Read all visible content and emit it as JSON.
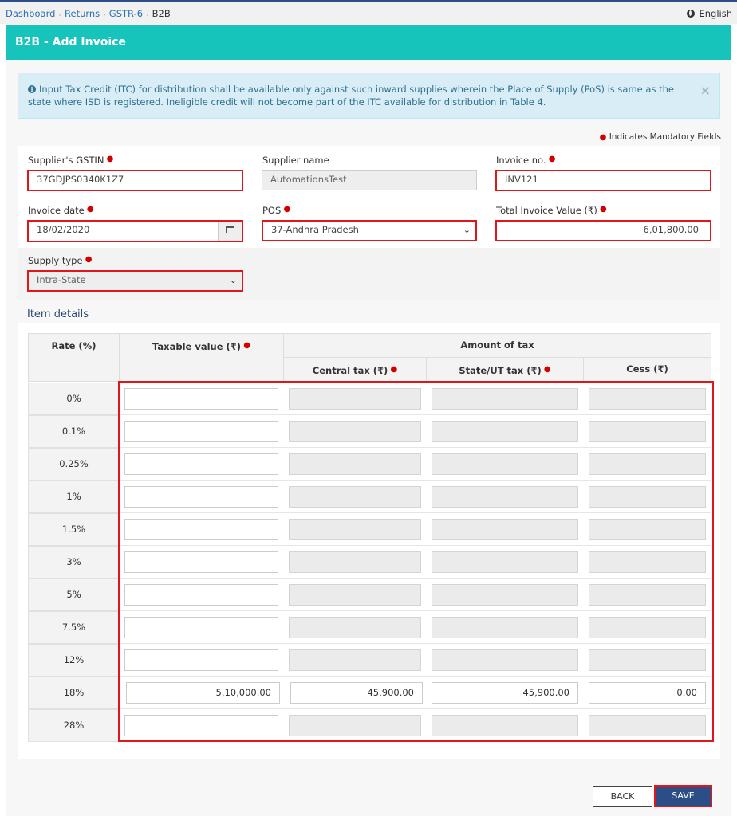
{
  "breadcrumb": [
    "Dashboard",
    "Returns",
    "GSTR-6",
    "B2B"
  ],
  "language": "English",
  "header": {
    "title": "B2B - Add Invoice"
  },
  "info": {
    "text": "Input Tax Credit (ITC) for distribution shall be available only against such inward supplies wherein the Place of Supply (PoS) is same as the state where ISD is registered. Ineligible credit will not become part of the ITC available for distribution in Table 4.",
    "close": "×"
  },
  "mandatory_note": "Indicates Mandatory Fields",
  "form": {
    "supplier_gstin": {
      "label": "Supplier's GSTIN",
      "value": "37GDJPS0340K1Z7"
    },
    "supplier_name": {
      "label": "Supplier name",
      "value": "AutomationsTest"
    },
    "invoice_no": {
      "label": "Invoice no.",
      "value": "INV121"
    },
    "invoice_date": {
      "label": "Invoice date",
      "value": "18/02/2020"
    },
    "pos": {
      "label": "POS",
      "value": "37-Andhra Pradesh"
    },
    "total_value": {
      "label": "Total Invoice Value (₹)",
      "value": "6,01,800.00"
    },
    "supply_type": {
      "label": "Supply type",
      "value": "Intra-State"
    }
  },
  "items": {
    "title": "Item details",
    "headers": {
      "rate": "Rate (%)",
      "taxable": "Taxable value (₹)",
      "amount_of_tax": "Amount of tax",
      "central": "Central tax (₹)",
      "state": "State/UT tax (₹)",
      "cess": "Cess (₹)"
    },
    "rows": [
      {
        "rate": "0%",
        "taxable": "",
        "central": "",
        "state": "",
        "cess": ""
      },
      {
        "rate": "0.1%",
        "taxable": "",
        "central": "",
        "state": "",
        "cess": ""
      },
      {
        "rate": "0.25%",
        "taxable": "",
        "central": "",
        "state": "",
        "cess": ""
      },
      {
        "rate": "1%",
        "taxable": "",
        "central": "",
        "state": "",
        "cess": ""
      },
      {
        "rate": "1.5%",
        "taxable": "",
        "central": "",
        "state": "",
        "cess": ""
      },
      {
        "rate": "3%",
        "taxable": "",
        "central": "",
        "state": "",
        "cess": ""
      },
      {
        "rate": "5%",
        "taxable": "",
        "central": "",
        "state": "",
        "cess": ""
      },
      {
        "rate": "7.5%",
        "taxable": "",
        "central": "",
        "state": "",
        "cess": ""
      },
      {
        "rate": "12%",
        "taxable": "",
        "central": "",
        "state": "",
        "cess": ""
      },
      {
        "rate": "18%",
        "taxable": "5,10,000.00",
        "central": "45,900.00",
        "state": "45,900.00",
        "cess": "0.00"
      },
      {
        "rate": "28%",
        "taxable": "",
        "central": "",
        "state": "",
        "cess": ""
      }
    ]
  },
  "buttons": {
    "back": "BACK",
    "save": "SAVE"
  },
  "colors": {
    "header": "#17c4bb",
    "primary": "#2c4e86",
    "highlight": "#e0161a",
    "info_bg": "#d9edf7"
  }
}
